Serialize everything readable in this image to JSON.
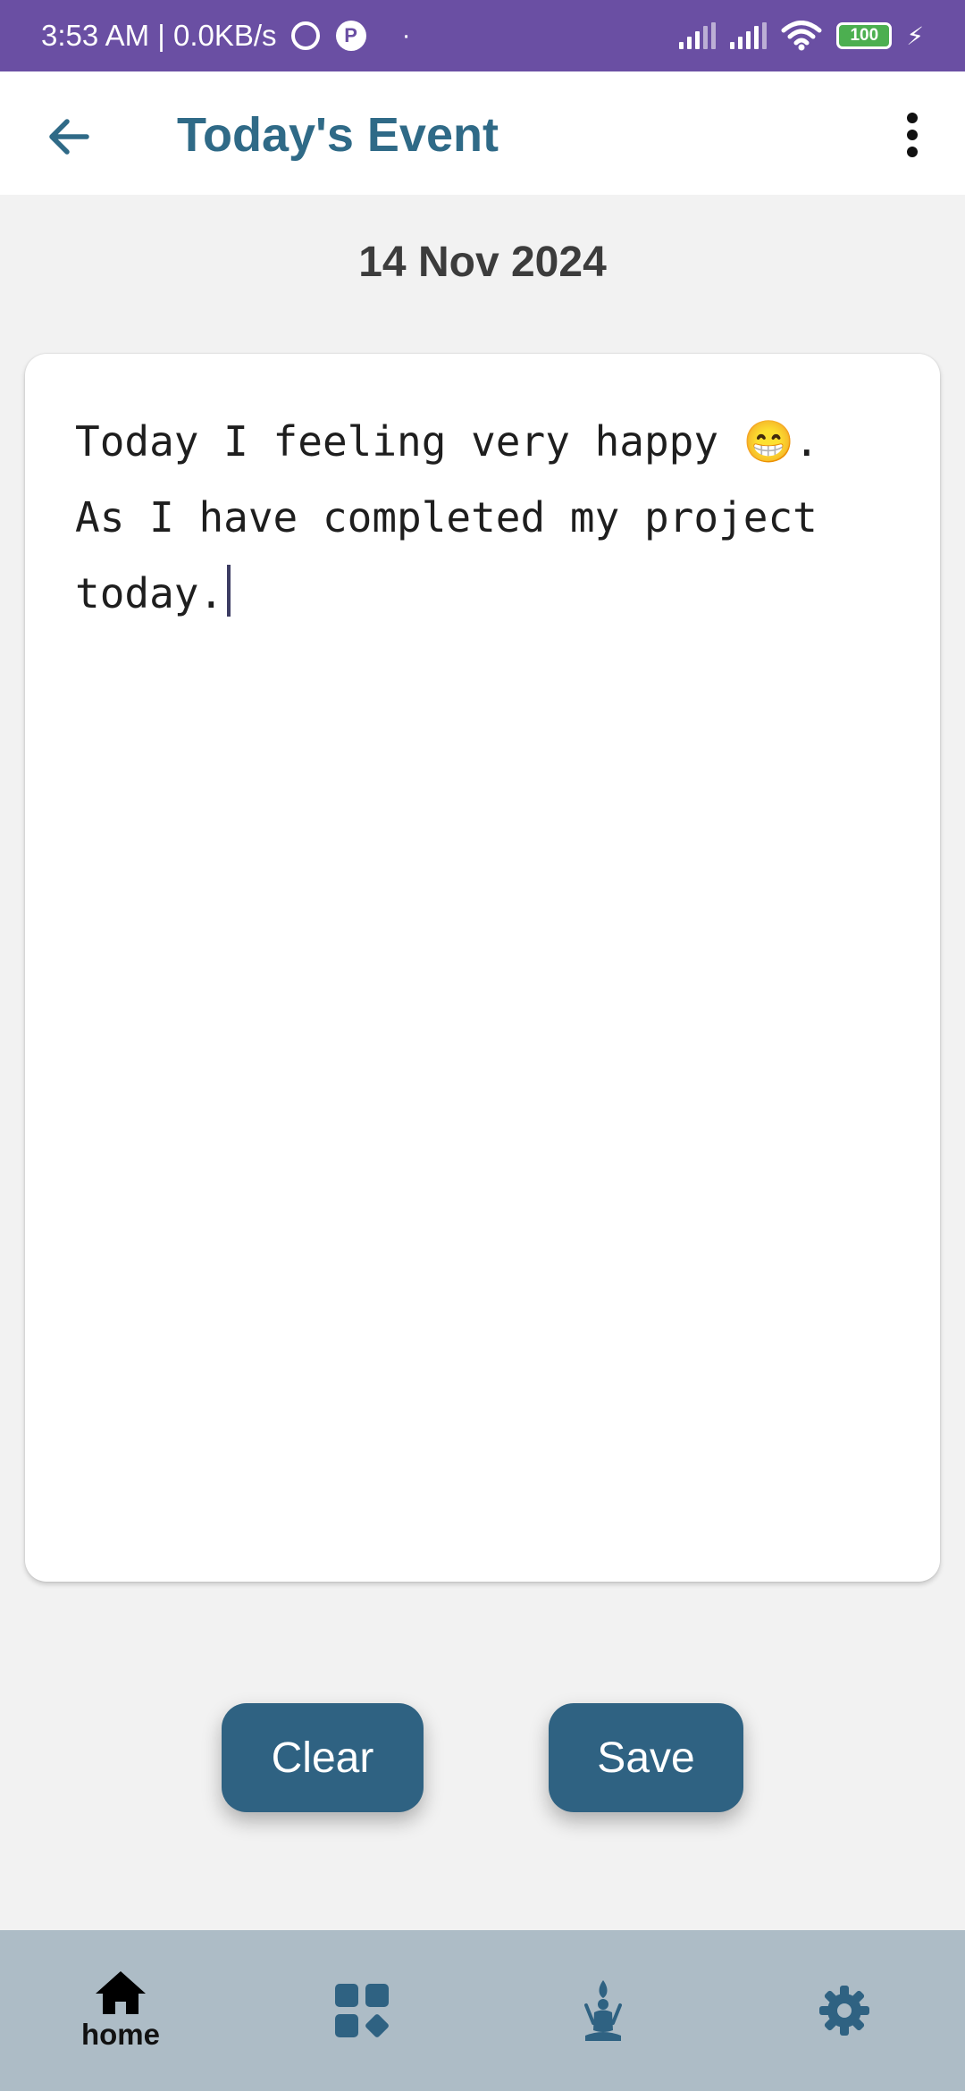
{
  "status_bar": {
    "time_speed": "3:53 AM | 0.0KB/s",
    "dot": "·",
    "battery": "100"
  },
  "app_bar": {
    "title": "Today's Event"
  },
  "date": "14 Nov 2024",
  "editor": {
    "text": "Today I feeling very happy 😁. As I have completed my project today."
  },
  "buttons": {
    "clear": "Clear",
    "save": "Save"
  },
  "bottom_nav": {
    "home_label": "home",
    "icons": [
      "home-icon",
      "dashboard-icon",
      "meditation-icon",
      "settings-icon"
    ]
  },
  "colors": {
    "status_bar": "#6a4fa3",
    "title": "#2f6a87",
    "button": "#2f6282",
    "nav_bg": "#adbcc6"
  }
}
